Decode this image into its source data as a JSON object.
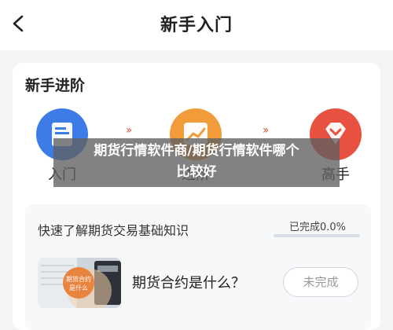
{
  "header": {
    "title": "新手入门"
  },
  "card": {
    "title": "新手进阶",
    "steps": [
      {
        "label": "入门",
        "color": "#3d7be6"
      },
      {
        "label": "进阶",
        "color": "#f29b3a"
      },
      {
        "label": "高手",
        "color": "#e8503f"
      }
    ],
    "course": {
      "title": "快速了解期货交易基础知识",
      "progress_text": "已完成0.0%",
      "progress_fraction": 0.0,
      "lesson": {
        "title": "期货合约是什么？",
        "thumb_caption_line1": "期货合约",
        "thumb_caption_line2": "是什么",
        "status": "未完成"
      }
    }
  },
  "overlay": {
    "line1": "期货行情软件商/期货行情软件哪个",
    "line2": "比较好"
  },
  "colors": {
    "accent_blue": "#3d6bd9",
    "chevron_red": "#e4553c"
  }
}
